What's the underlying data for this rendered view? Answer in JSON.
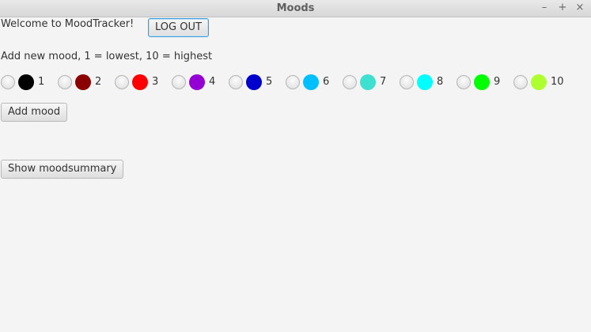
{
  "window": {
    "title": "Moods",
    "minimize_glyph": "–",
    "maximize_glyph": "+",
    "close_glyph": "×"
  },
  "header": {
    "welcome_text": "Welcome to MoodTracker!",
    "logout_label": "LOG OUT"
  },
  "mood_form": {
    "instruction": "Add new mood, 1 = lowest, 10 = highest",
    "options": [
      {
        "label": "1",
        "color": "#000000"
      },
      {
        "label": "2",
        "color": "#8b0000"
      },
      {
        "label": "3",
        "color": "#ff0000"
      },
      {
        "label": "4",
        "color": "#9400d3"
      },
      {
        "label": "5",
        "color": "#0000cd"
      },
      {
        "label": "6",
        "color": "#00bfff"
      },
      {
        "label": "7",
        "color": "#40e0d0"
      },
      {
        "label": "8",
        "color": "#00ffff"
      },
      {
        "label": "9",
        "color": "#00ff00"
      },
      {
        "label": "10",
        "color": "#adff2f"
      }
    ],
    "add_label": "Add mood"
  },
  "summary": {
    "show_label": "Show moodsummary"
  }
}
